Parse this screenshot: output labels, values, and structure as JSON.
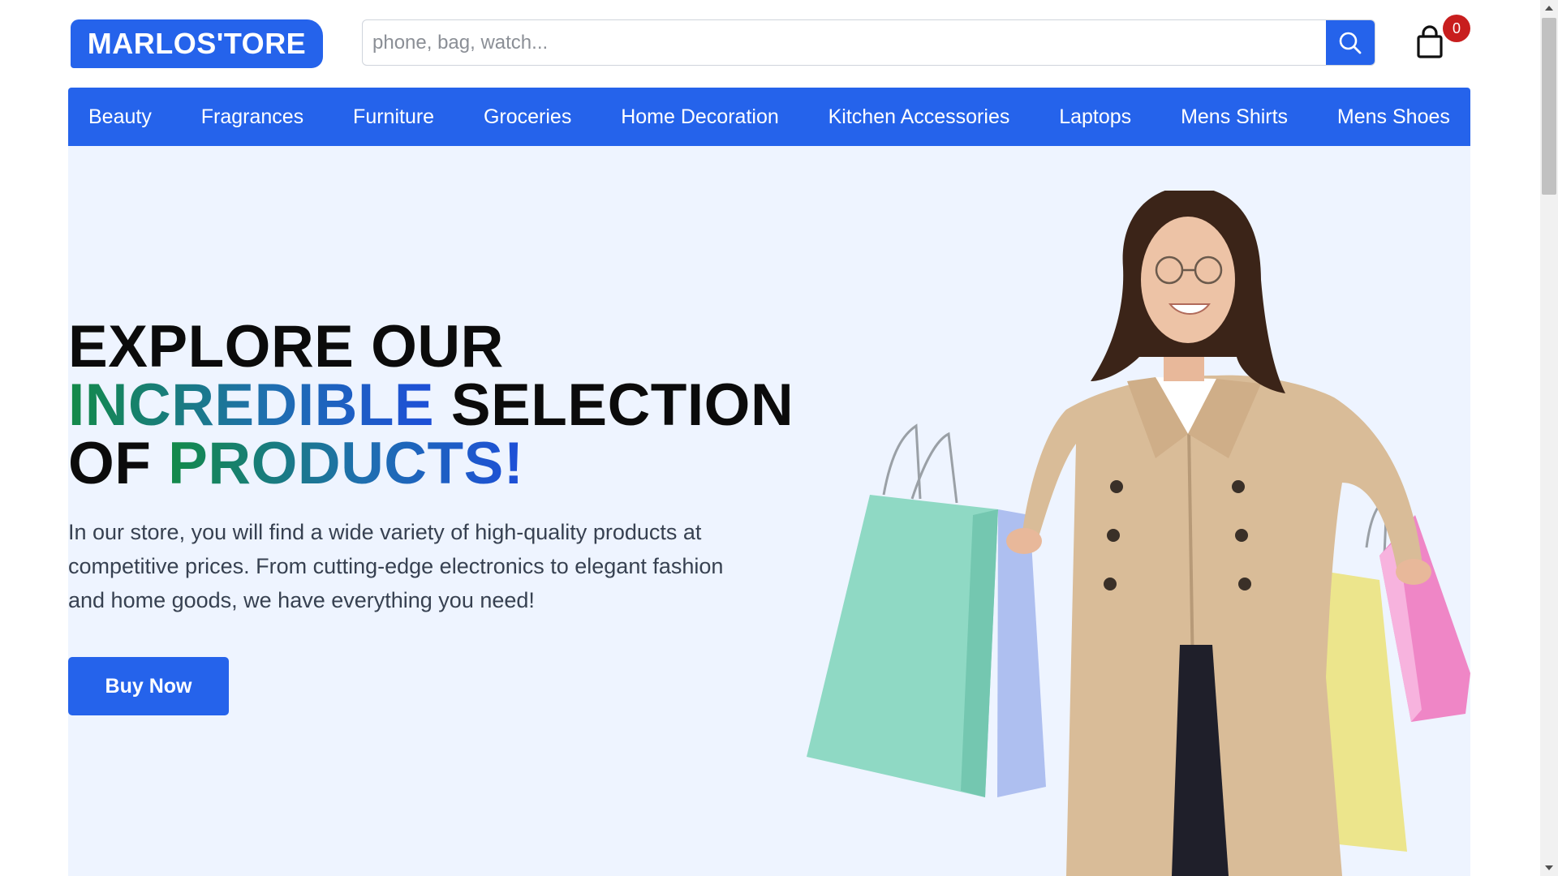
{
  "header": {
    "logo_text": "MARLOS'TORE",
    "search": {
      "placeholder": "phone, bag, watch...",
      "value": "",
      "button_icon": "search-icon"
    },
    "cart": {
      "icon": "shopping-bag-icon",
      "count": "0"
    }
  },
  "nav": {
    "items": [
      {
        "label": "Beauty"
      },
      {
        "label": "Fragrances"
      },
      {
        "label": "Furniture"
      },
      {
        "label": "Groceries"
      },
      {
        "label": "Home Decoration"
      },
      {
        "label": "Kitchen Accessories"
      },
      {
        "label": "Laptops"
      },
      {
        "label": "Mens Shirts"
      },
      {
        "label": "Mens Shoes"
      }
    ]
  },
  "hero": {
    "headline": {
      "line1": "EXPLORE OUR",
      "line2_highlight": "INCREDIBLE",
      "line2_rest": " SELECTION",
      "line3_start": "OF ",
      "line3_highlight": "PRODUCTS!"
    },
    "description": "In our store, you will find a wide variety of high-quality products at competitive prices. From cutting-edge electronics to elegant fashion and home goods, we have everything you need!",
    "cta_label": "Buy Now",
    "image": "woman-with-shopping-bags-image"
  },
  "colors": {
    "primary": "#2563eb",
    "hero_background": "#eef4ff",
    "badge": "#c81e1e",
    "gradient_start": "#138a48",
    "gradient_end": "#1d4ed8"
  }
}
